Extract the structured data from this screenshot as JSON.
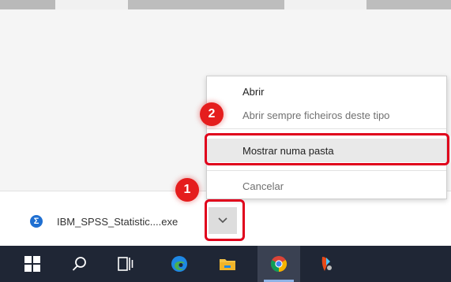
{
  "download_bar": {
    "file_icon_glyph": "Σ",
    "file_name": "IBM_SPSS_Statistic....exe"
  },
  "context_menu": {
    "items": [
      {
        "label": "Abrir",
        "enabled": true
      },
      {
        "label": "Abrir sempre ficheiros deste tipo",
        "enabled": false
      },
      {
        "label": "Mostrar numa pasta",
        "enabled": true,
        "highlighted": true
      },
      {
        "label": "Cancelar",
        "enabled": false
      }
    ]
  },
  "markers": {
    "step1": "1",
    "step2": "2"
  },
  "taskbar": {
    "icons": [
      "windows-start-icon",
      "search-icon",
      "task-view-icon",
      "edge-icon",
      "file-explorer-icon",
      "chrome-icon",
      "app-icon"
    ],
    "active": "chrome-icon"
  },
  "colors": {
    "highlight_red": "#e0001b",
    "taskbar_bg": "#1f2635",
    "menu_disabled_text": "#707070"
  }
}
